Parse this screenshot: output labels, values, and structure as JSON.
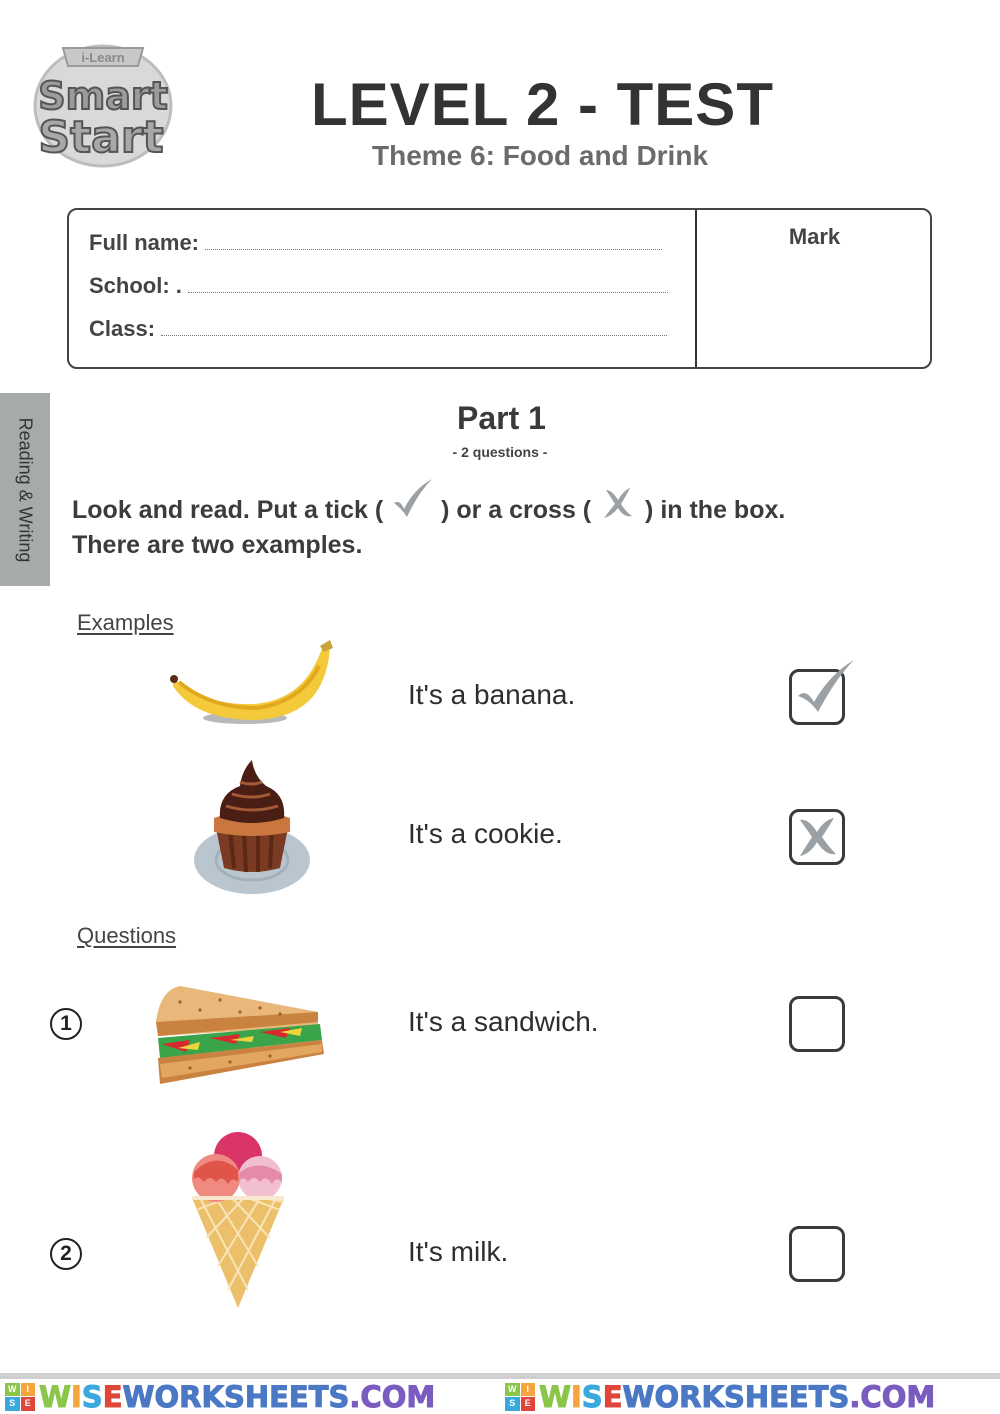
{
  "logo": {
    "top_text": "i-Learn",
    "line1": "Smart",
    "line2": "Start"
  },
  "header": {
    "title": "LEVEL 2 - TEST",
    "subtitle": "Theme 6: Food and Drink"
  },
  "info_box": {
    "fields": [
      {
        "label": "Full name:",
        "value": ""
      },
      {
        "label": "School: .",
        "value": ""
      },
      {
        "label": "Class:",
        "value": ""
      }
    ],
    "mark_label": "Mark",
    "mark_value": ""
  },
  "side_tab": {
    "label": "Reading & Writing"
  },
  "part": {
    "title": "Part 1",
    "subtitle": "- 2 questions -",
    "instruction_line1_a": "Look and read. Put a tick (",
    "instruction_line1_b": ") or a cross (",
    "instruction_line1_c": ") in the box.",
    "instruction_line2": "There are two examples.",
    "tick_icon": "tick-icon",
    "cross_icon": "cross-icon"
  },
  "examples": {
    "label": "Examples",
    "items": [
      {
        "picture": "banana",
        "sentence": "It's a banana.",
        "answer": "tick"
      },
      {
        "picture": "cupcake",
        "sentence": "It's a cookie.",
        "answer": "cross"
      }
    ]
  },
  "questions": {
    "label": "Questions",
    "items": [
      {
        "number": "1",
        "picture": "sandwich",
        "sentence": "It's a sandwich.",
        "answer": ""
      },
      {
        "number": "2",
        "picture": "ice-cream",
        "sentence": "It's milk.",
        "answer": ""
      }
    ]
  },
  "footer": {
    "badge": [
      "W",
      "I",
      "S",
      "E"
    ],
    "brand_parts": [
      "W",
      "I",
      "S",
      "E",
      "WORKSHEETS",
      ".COM"
    ],
    "colors": {
      "green": "#8bc64a",
      "orange": "#f4a53b",
      "cyan": "#3aa7dd",
      "red": "#e0453a",
      "blue": "#4a78c5",
      "purple": "#7a5cc0"
    }
  },
  "colors": {
    "text_dark": "#333333",
    "subtitle_gray": "#6b6b6b",
    "mark_gray": "#9aa0a3",
    "side_tab_bg": "#a7aaab"
  }
}
